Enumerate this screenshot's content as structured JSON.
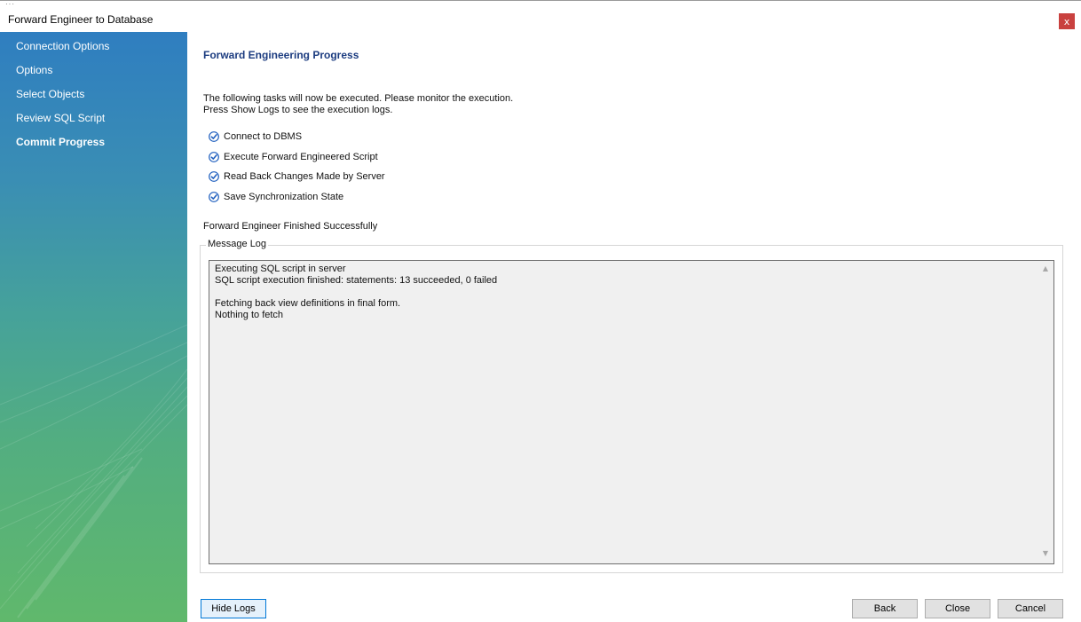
{
  "window": {
    "title": "Forward Engineer to Database",
    "close_label": "x"
  },
  "sidebar": {
    "items": [
      {
        "label": "Connection Options",
        "active": false
      },
      {
        "label": "Options",
        "active": false
      },
      {
        "label": "Select Objects",
        "active": false
      },
      {
        "label": "Review SQL Script",
        "active": false
      },
      {
        "label": "Commit Progress",
        "active": true
      }
    ]
  },
  "main": {
    "heading": "Forward Engineering Progress",
    "description_lines": [
      "The following tasks will now be executed. Please monitor the execution.",
      "Press Show Logs to see the execution logs."
    ],
    "tasks": [
      {
        "label": "Connect to DBMS",
        "done": true
      },
      {
        "label": "Execute Forward Engineered Script",
        "done": true
      },
      {
        "label": "Read Back Changes Made by Server",
        "done": true
      },
      {
        "label": "Save Synchronization State",
        "done": true
      }
    ],
    "status": "Forward Engineer Finished Successfully",
    "log": {
      "legend": "Message Log",
      "lines": [
        "Executing SQL script in server",
        "SQL script execution finished: statements: 13 succeeded, 0 failed",
        "",
        "Fetching back view definitions in final form.",
        "Nothing to fetch"
      ]
    }
  },
  "footer": {
    "hide_logs": "Hide Logs",
    "back": "Back",
    "close": "Close",
    "cancel": "Cancel"
  },
  "icons": {
    "check": "check-circle-icon",
    "scroll_up": "chevron-up-icon",
    "scroll_down": "chevron-down-icon"
  },
  "colors": {
    "accent": "#1c3c80",
    "close_button": "#c9413f",
    "check": "#1f5fbf",
    "sidebar_top": "#2f7ec0",
    "sidebar_bottom": "#60b86c"
  }
}
